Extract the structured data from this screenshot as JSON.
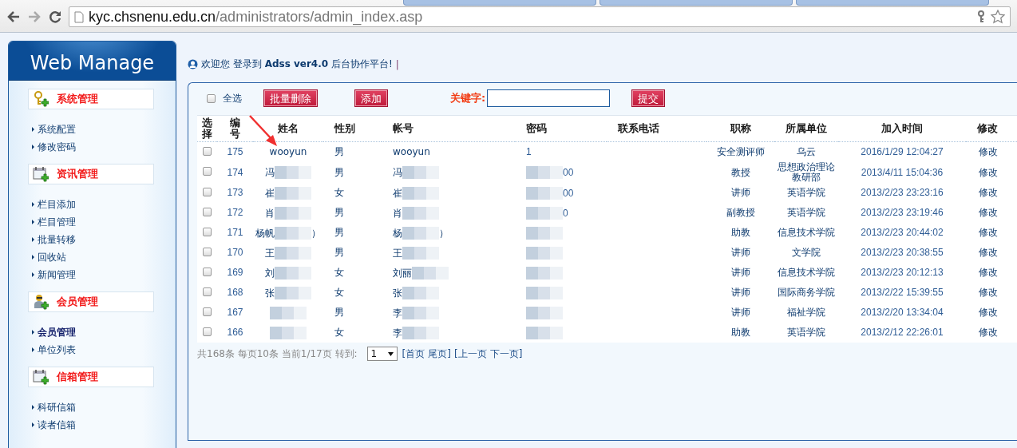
{
  "browser": {
    "url_host": "kyc.chsnenu.edu.cn",
    "url_path": "/administrators/admin_index.asp"
  },
  "sidebar": {
    "title": "Web Manage",
    "groups": [
      {
        "label": "系统管理",
        "kind": "key",
        "items": [
          {
            "label": "系统配置",
            "selected": false
          },
          {
            "label": "修改密码",
            "selected": false
          }
        ]
      },
      {
        "label": "资讯管理",
        "kind": "calendar",
        "items": [
          {
            "label": "栏目添加",
            "selected": false
          },
          {
            "label": "栏目管理",
            "selected": false
          },
          {
            "label": "批量转移",
            "selected": false
          },
          {
            "label": "回收站",
            "selected": false
          },
          {
            "label": "新闻管理",
            "selected": false
          }
        ]
      },
      {
        "label": "会员管理",
        "kind": "user",
        "items": [
          {
            "label": "会员管理",
            "selected": true
          },
          {
            "label": "单位列表",
            "selected": false
          }
        ]
      },
      {
        "label": "信箱管理",
        "kind": "calendar",
        "items": [
          {
            "label": "科研信箱",
            "selected": false
          },
          {
            "label": "读者信箱",
            "selected": false
          }
        ]
      }
    ]
  },
  "welcome": {
    "text": "欢迎您 登录到 **Adss  ver4.0** 后台协作平台!",
    "separator": "|"
  },
  "toolbar": {
    "select_all": {
      "label": "全选",
      "checked": false
    },
    "buttons": [
      "批量删除",
      "添加"
    ],
    "keyword_label": "关键字:",
    "submit": "提交"
  },
  "table": {
    "columns": [
      "选择",
      "编号",
      "姓名",
      "性别",
      "帐号",
      "密码",
      "联系电话",
      "职称",
      "所属单位",
      "加入时间",
      "修改"
    ],
    "rows": [
      {
        "checked": false,
        "redacted": false,
        "id": "175",
        "name": "wooyun",
        "gender": "男",
        "account": "wooyun",
        "password": "1",
        "title": "安全测评师",
        "unit": "乌云",
        "joined": "2016/1/29 12:04:27",
        "edit": "修改"
      },
      {
        "checked": false,
        "redacted": true,
        "id": "174",
        "name": "冯",
        "gender": "男",
        "account": "冯",
        "password": "00",
        "title": "教授",
        "unit": "思想政治理论教研部",
        "joined": "2013/4/11 15:04:36",
        "edit": "修改"
      },
      {
        "checked": false,
        "redacted": true,
        "id": "173",
        "name": "崔",
        "gender": "女",
        "account": "崔",
        "password": "00",
        "title": "讲师",
        "unit": "英语学院",
        "joined": "2013/2/23 23:23:16",
        "edit": "修改"
      },
      {
        "checked": false,
        "redacted": true,
        "id": "172",
        "name": "肖",
        "gender": "男",
        "account": "肖",
        "password": "0",
        "title": "副教授",
        "unit": "英语学院",
        "joined": "2013/2/23 23:19:46",
        "edit": "修改"
      },
      {
        "checked": false,
        "redacted": true,
        "id": "171",
        "name": "杨帆",
        "name_end": "）",
        "gender": "男",
        "account": "杨",
        "account_end": "）",
        "title": "助教",
        "unit": "信息技术学院",
        "joined": "2013/2/23 20:44:02",
        "edit": "修改"
      },
      {
        "checked": false,
        "redacted": true,
        "id": "170",
        "name": "王",
        "gender": "男",
        "account": "王",
        "title": "讲师",
        "unit": "文学院",
        "joined": "2013/2/23 20:38:55",
        "edit": "修改"
      },
      {
        "checked": false,
        "redacted": true,
        "id": "169",
        "name": "刘",
        "gender": "女",
        "account": "刘丽",
        "title": "讲师",
        "unit": "信息技术学院",
        "joined": "2013/2/23 20:12:13",
        "edit": "修改"
      },
      {
        "checked": false,
        "redacted": true,
        "id": "168",
        "name": "张",
        "gender": "女",
        "account": "张",
        "title": "讲师",
        "unit": "国际商务学院",
        "joined": "2013/2/22 15:39:55",
        "edit": "修改"
      },
      {
        "checked": false,
        "redacted": true,
        "id": "167",
        "gender": "男",
        "account": "李",
        "title": "讲师",
        "unit": "福祉学院",
        "joined": "2013/2/20 13:34:04",
        "edit": "修改"
      },
      {
        "checked": false,
        "redacted": true,
        "id": "166",
        "gender": "女",
        "account": "李",
        "title": "助教",
        "unit": "英语学院",
        "joined": "2013/2/12 22:26:01",
        "edit": "修改"
      }
    ]
  },
  "pagination": {
    "summary": "共168条 每页10条 当前1/17页 转到:",
    "page": "1",
    "links": [
      "[首页",
      "尾页]",
      "[上一页",
      "下一页]"
    ]
  }
}
